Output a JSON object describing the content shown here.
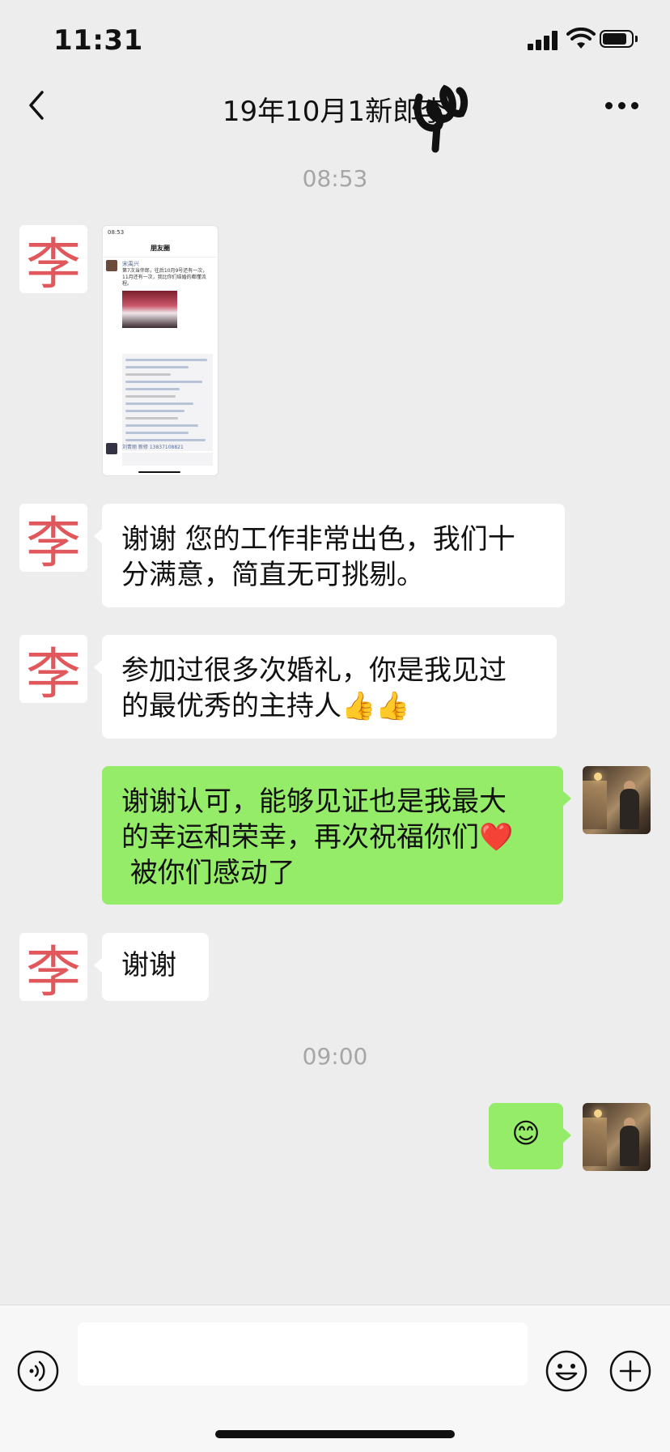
{
  "status_bar": {
    "time": "11:31"
  },
  "nav": {
    "title": "19年10月1新郎李",
    "back_icon": "chevron-left-icon",
    "more_icon": "more-dots-icon"
  },
  "timestamps": [
    "08:53",
    "09:00"
  ],
  "contact_avatar_char": "李",
  "messages": [
    {
      "side": "left",
      "type": "image",
      "text": ""
    },
    {
      "side": "left",
      "type": "text",
      "text": "谢谢 您的工作非常出色，我们十\n分满意，简直无可挑剔。"
    },
    {
      "side": "left",
      "type": "text",
      "text": "参加过很多次婚礼，你是我见过\n的最优秀的主持人👍👍"
    },
    {
      "side": "right",
      "type": "text",
      "text": "谢谢认可，能够见证也是我最大\n的幸运和荣幸，再次祝福你们❤️\n 被你们感动了"
    },
    {
      "side": "left",
      "type": "text",
      "text": "谢谢"
    },
    {
      "side": "right",
      "type": "text",
      "text": "😊"
    }
  ],
  "shared_screenshot": {
    "status_time": "08:53",
    "page_title": "朋友圈",
    "poster_name": "宋禹兴",
    "post_text": "第7次当伴郎，往后10月9号还有一次，11月还有一次，我比你们结婚的都懂流程。",
    "footer_name": "刘青丽 新修 13837108821"
  },
  "input_bar": {
    "voice_icon": "voice-icon",
    "emoji_icon": "emoji-icon",
    "plus_icon": "plus-icon"
  },
  "colors": {
    "background": "#ededed",
    "sent_bubble": "#95ec69",
    "received_bubble": "#ffffff",
    "timestamp": "#a6a6a6",
    "avatar_char": "#e0585c"
  }
}
